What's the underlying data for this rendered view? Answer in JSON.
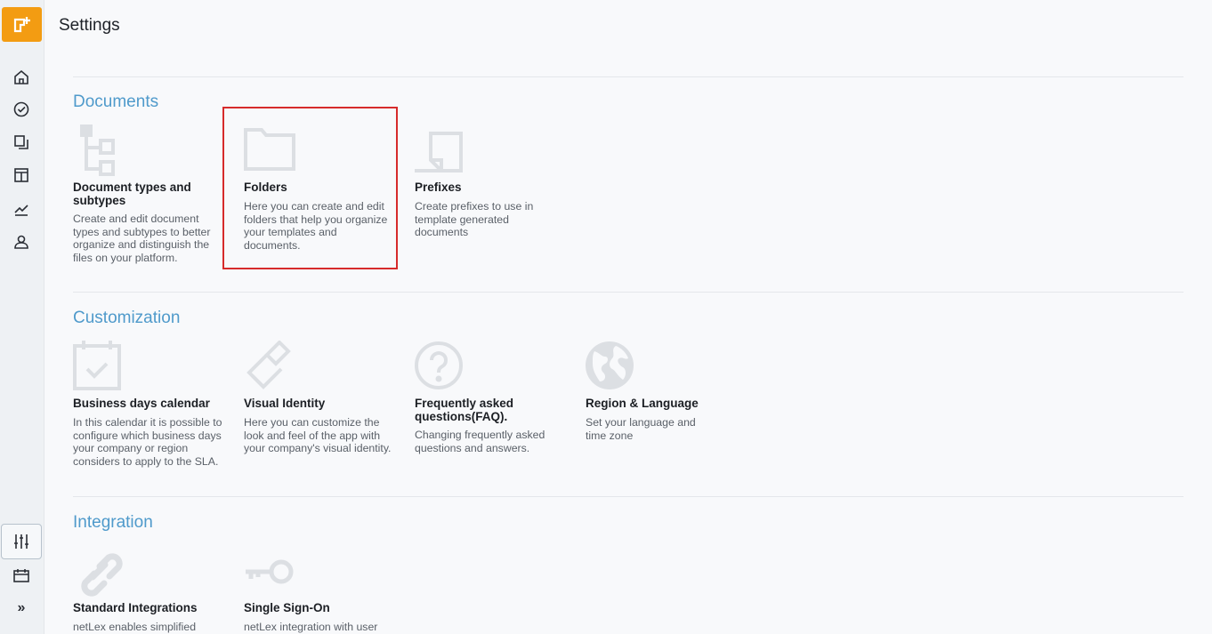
{
  "header": {
    "title": "Settings"
  },
  "sidebar": {
    "items": [
      {
        "icon": "home-icon"
      },
      {
        "icon": "check-circle-icon"
      },
      {
        "icon": "documents-icon"
      },
      {
        "icon": "board-icon"
      },
      {
        "icon": "chart-icon"
      },
      {
        "icon": "user-icon"
      },
      {
        "icon": "sliders-icon",
        "active": true
      },
      {
        "icon": "calendar-icon"
      },
      {
        "icon": "expand-icon",
        "glyph": "»"
      }
    ]
  },
  "sections": [
    {
      "title": "Documents",
      "cards": [
        {
          "title": "Document types and subtypes",
          "desc": "Create and edit document types and subtypes to better organize and distinguish the files on your platform.",
          "icon": "hierarchy-icon"
        },
        {
          "title": "Folders",
          "desc": "Here you can create and edit folders that help you organize your templates and documents.",
          "icon": "folder-icon"
        },
        {
          "title": "Prefixes",
          "desc": "Create prefixes to use in template generated documents",
          "icon": "prefix-document-icon"
        }
      ]
    },
    {
      "title": "Customization",
      "cards": [
        {
          "title": "Business days calendar",
          "desc": "In this calendar it is possible to configure which business days your company or region considers to apply to the SLA.",
          "icon": "calendar-check-icon"
        },
        {
          "title": "Visual Identity",
          "desc": "Here you can customize the look and feel of the app with your company's visual identity.",
          "icon": "paint-brush-icon"
        },
        {
          "title": "Frequently asked questions(FAQ).",
          "desc": "Changing frequently asked questions and answers.",
          "icon": "question-circle-icon"
        },
        {
          "title": "Region & Language",
          "desc": "Set your language and time zone",
          "icon": "globe-icon"
        }
      ]
    },
    {
      "title": "Integration",
      "cards": [
        {
          "title": "Standard Integrations",
          "desc": "netLex enables simplified",
          "icon": "link-icon"
        },
        {
          "title": "Single Sign-On",
          "desc": "netLex integration with user",
          "icon": "key-icon"
        }
      ]
    }
  ],
  "colors": {
    "accent": "#4f9acb",
    "brand": "#f39c12",
    "highlight": "#d62b2b",
    "icon_gray": "#dcdfe3"
  }
}
